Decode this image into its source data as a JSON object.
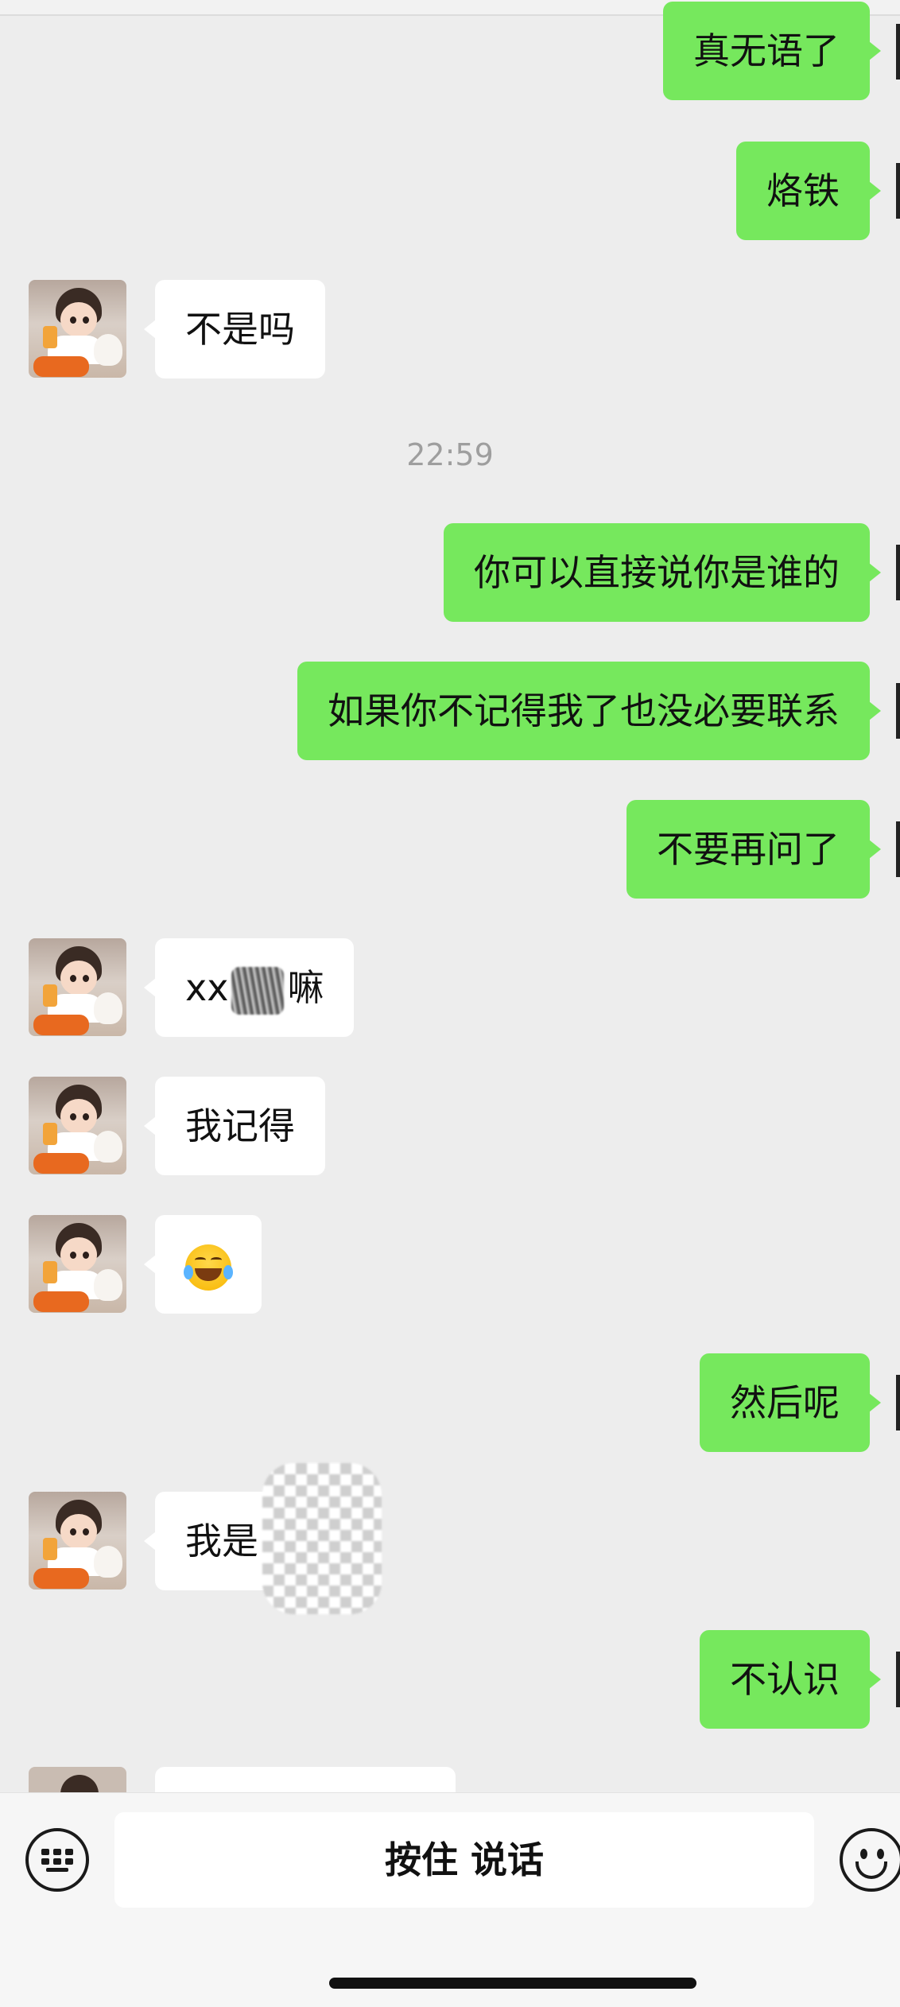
{
  "messages": [
    {
      "from": "me",
      "text": "真无语了"
    },
    {
      "from": "me",
      "text": "烙铁"
    },
    {
      "from": "other",
      "text": "不是吗"
    },
    {
      "type": "time",
      "text": "22:59"
    },
    {
      "from": "me",
      "text": "你可以直接说你是谁的"
    },
    {
      "from": "me",
      "text": "如果你不记得我了也没必要联系"
    },
    {
      "from": "me",
      "text": "不要再问了"
    },
    {
      "from": "other",
      "text_before": "xx",
      "text_after": "嘛",
      "note_hidden": "scribbled-out"
    },
    {
      "from": "other",
      "text": "我记得"
    },
    {
      "from": "other",
      "emoji": "face-with-tears-of-joy-icon"
    },
    {
      "from": "me",
      "text": "然后呢"
    },
    {
      "from": "other",
      "text": "我是",
      "note_hidden": "mosaic-covered"
    },
    {
      "from": "me",
      "text": "不认识"
    }
  ],
  "bottom_bar": {
    "hold_to_talk_label": "按住 说话",
    "left_icon": "keyboard-icon",
    "right_icon": "emoji-icon"
  },
  "colors": {
    "background": "#ededed",
    "outgoing_bubble": "#76e85d",
    "incoming_bubble": "#ffffff",
    "timestamp": "#9e9e9e"
  }
}
